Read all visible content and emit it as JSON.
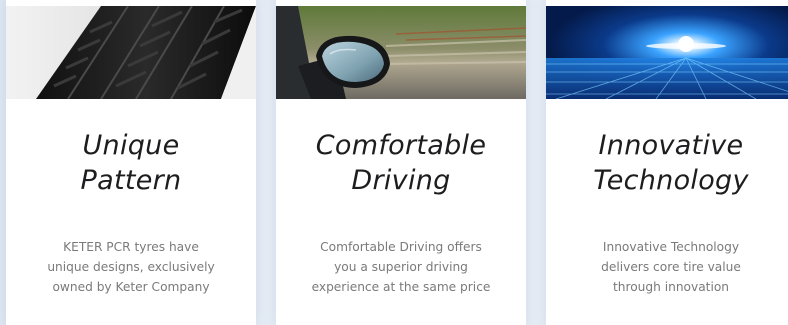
{
  "cards": [
    {
      "image_icon": "tire-tread-image",
      "title_lines": [
        "Unique",
        "Pattern"
      ],
      "description_lines": [
        "KETER PCR tyres have",
        "unique designs, exclusively",
        "owned by Keter Company"
      ]
    },
    {
      "image_icon": "car-side-mirror-image",
      "title_lines": [
        "Comfortable",
        "Driving"
      ],
      "description_lines": [
        "Comfortable Driving offers",
        "you a superior driving",
        "experience at the same price"
      ]
    },
    {
      "image_icon": "technology-light-grid-image",
      "title_lines": [
        "Innovative",
        "Technology"
      ],
      "description_lines": [
        "Innovative Technology",
        "delivers core tire value",
        "through innovation"
      ]
    }
  ],
  "colors": {
    "title": "#1d1d1f",
    "description": "#7a7a7a",
    "card_background": "#ffffff",
    "page_background": "#e8eef6"
  }
}
